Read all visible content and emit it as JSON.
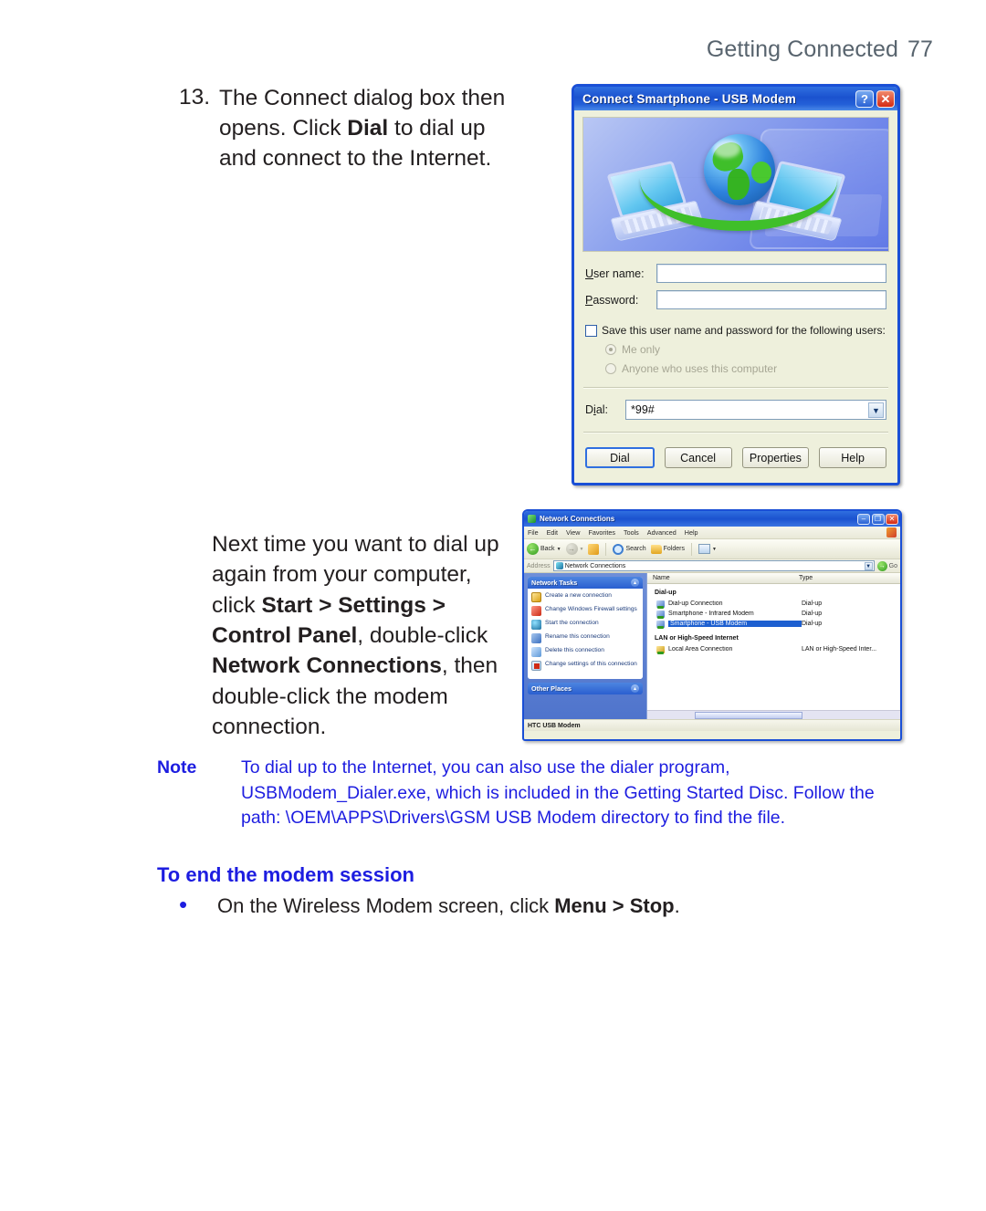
{
  "running_head": {
    "section": "Getting Connected",
    "page": "77"
  },
  "step13": {
    "number": "13.",
    "text_before_bold": "The Connect dialog box then opens. Click ",
    "bold": "Dial",
    "text_after_bold": " to dial up and connect to the Internet."
  },
  "connect_dialog": {
    "title": "Connect Smartphone - USB Modem",
    "help_button": "?",
    "close_button": "✕",
    "banner_alt": "globe-and-laptops-illustration",
    "username_label": "User name:",
    "username_value": "",
    "password_label": "Password:",
    "password_value": "",
    "save_checkbox_label": "Save this user name and password for the following users:",
    "save_checked": false,
    "radio_me_only": "Me only",
    "radio_anyone": "Anyone who uses this computer",
    "dial_label": "Dial:",
    "dial_value": "*99#",
    "buttons": [
      "Dial",
      "Cancel",
      "Properties",
      "Help"
    ]
  },
  "next_time": {
    "line1": "Next time you want to dial up again from your computer, click ",
    "b1": "Start > Settings > Control Panel",
    "mid1": ", double-click ",
    "b2": "Network Connections",
    "mid2": ", then double-click the modem connection."
  },
  "network_connections": {
    "title": "Network Connections",
    "window_buttons": [
      "–",
      "❐",
      "✕"
    ],
    "menus": [
      "File",
      "Edit",
      "View",
      "Favorites",
      "Tools",
      "Advanced",
      "Help"
    ],
    "toolbar": {
      "back": "Back",
      "forward": "",
      "up": "",
      "search": "Search",
      "folders": "Folders",
      "views": ""
    },
    "address_label": "Address",
    "address_value": "Network Connections",
    "go_label": "Go",
    "tasks_panel": {
      "title": "Network Tasks",
      "items": [
        "Create a new connection",
        "Change Windows Firewall settings",
        "Start the connection",
        "Rename this connection",
        "Delete this connection",
        "Change settings of this connection"
      ]
    },
    "other_places_panel": {
      "title": "Other Places"
    },
    "columns": [
      "Name",
      "Type"
    ],
    "groups": [
      {
        "label": "Dial-up",
        "rows": [
          {
            "name": "Dial-up Connection",
            "type": "Dial-up",
            "selected": false
          },
          {
            "name": "Smartphone - Infrared Modem",
            "type": "Dial-up",
            "selected": false
          },
          {
            "name": "Smartphone - USB Modem",
            "type": "Dial-up",
            "selected": true
          }
        ]
      },
      {
        "label": "LAN or High-Speed Internet",
        "rows": [
          {
            "name": "Local Area Connection",
            "type": "LAN or High-Speed Inter...",
            "selected": false
          }
        ]
      }
    ],
    "status_text": "HTC USB Modem"
  },
  "note": {
    "label": "Note",
    "text": "To dial up to the Internet, you can also use the dialer program, USBModem_Dialer.exe, which is included in the Getting Started Disc. Follow the path: \\OEM\\APPS\\Drivers\\GSM USB Modem directory to find the file."
  },
  "end_session": {
    "title": "To end the modem session",
    "bullet": "•",
    "text_before": "On the Wireless Modem screen, click ",
    "bold": "Menu > Stop",
    "text_after": "."
  },
  "colors": {
    "accent_blue": "#1d1de0",
    "running_head": "#58646e",
    "body_text": "#231f20",
    "titlebar_blue": "#1b52cf"
  }
}
